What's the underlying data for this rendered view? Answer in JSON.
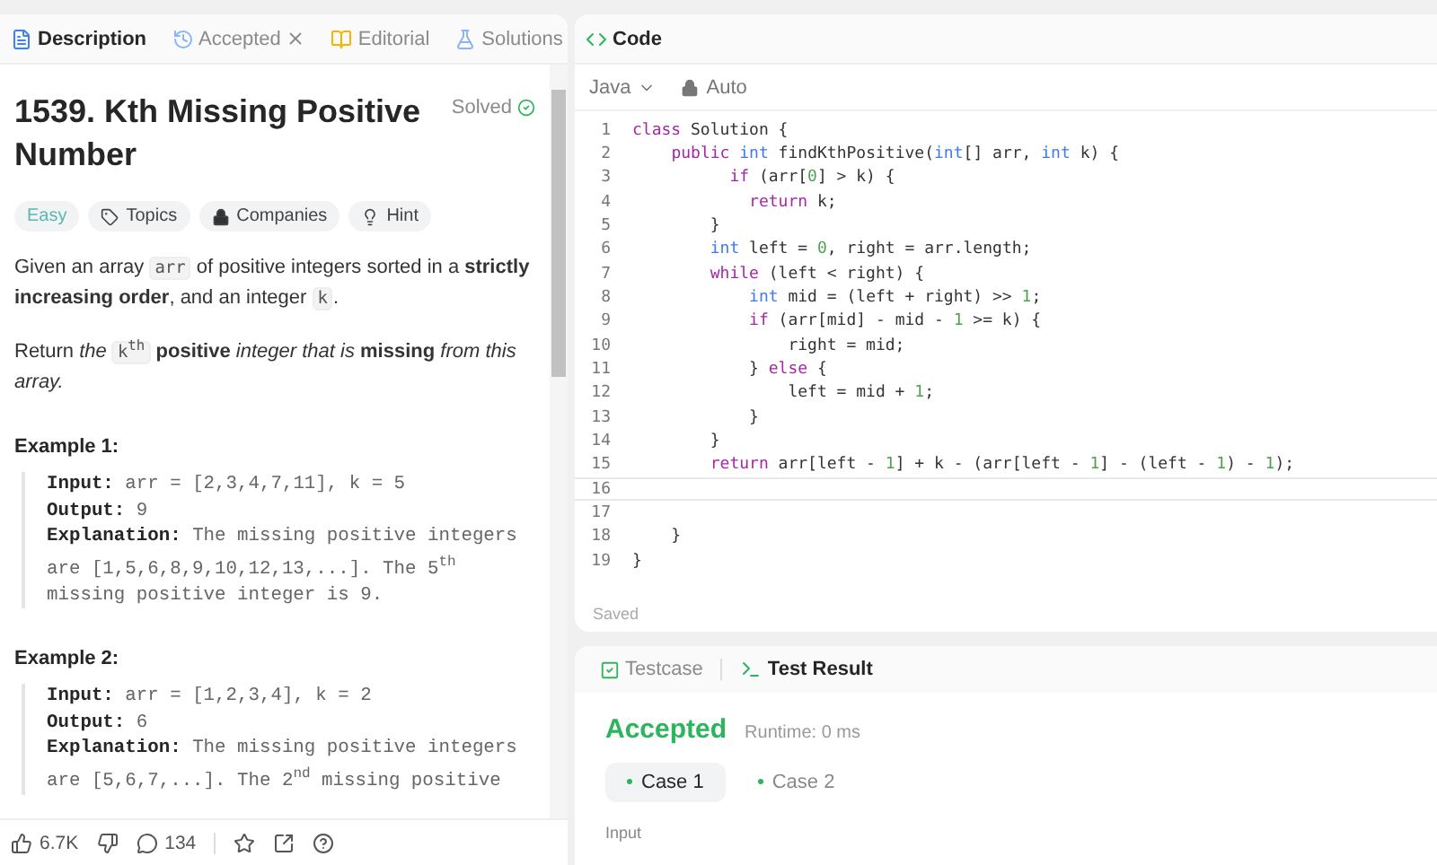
{
  "left_tabs": [
    {
      "label": "Description",
      "kind": "file",
      "selected": true,
      "closable": false
    },
    {
      "label": "Accepted",
      "kind": "history",
      "selected": false,
      "closable": true
    },
    {
      "label": "Editorial",
      "kind": "book",
      "selected": false,
      "closable": false
    },
    {
      "label": "Solutions",
      "kind": "flask",
      "selected": false,
      "closable": false
    }
  ],
  "problem": {
    "title": "1539. Kth Missing Positive Number",
    "status": "Solved",
    "tags": [
      {
        "label": "Easy",
        "kind": "difficulty"
      },
      {
        "label": "Topics",
        "kind": "tag"
      },
      {
        "label": "Companies",
        "kind": "lock"
      },
      {
        "label": "Hint",
        "kind": "bulb"
      }
    ],
    "paragraphs": [
      [
        {
          "kind": "text",
          "text": "Given an array "
        },
        {
          "kind": "code",
          "text": "arr"
        },
        {
          "kind": "text",
          "text": " of positive integers sorted in a **strictly increasing order**, and an integer "
        },
        {
          "kind": "code",
          "text": "k"
        },
        {
          "kind": "text",
          "text": "."
        }
      ],
      [
        {
          "kind": "text",
          "text": "Return *the* "
        },
        {
          "kind": "code",
          "text": "k$^{th}$"
        },
        {
          "kind": "text",
          "text": " **positive** *integer that is* **missing** *from this array.*"
        }
      ]
    ],
    "examples": [
      {
        "heading": "Example 1:",
        "lines": [
          "**Input:** arr = [2,3,4,7,11], k = 5",
          "**Output:** 9",
          "**Explanation:** The missing positive integers are [1,5,6,8,9,10,12,13,...]. The 5$^{th}$ missing positive integer is 9."
        ]
      },
      {
        "heading": "Example 2:",
        "lines": [
          "**Input:** arr = [1,2,3,4], k = 2",
          "**Output:** 6",
          "**Explanation:** The missing positive integers are [5,6,7,...]. The 2$^{nd}$ missing positive"
        ]
      }
    ]
  },
  "footer": {
    "likes": "6.7K",
    "comments": "134"
  },
  "code_panel": {
    "title": "Code",
    "language": "Java",
    "mode": "Auto",
    "status": "Saved",
    "lines": [
      {
        "number": "1",
        "text": "class Solution {",
        "current": false
      },
      {
        "number": "2",
        "text": "    public int findKthPositive(int[] arr, int k) {",
        "current": false
      },
      {
        "number": "3",
        "text": "          if (arr[0] > k) {",
        "current": false
      },
      {
        "number": "4",
        "text": "            return k;",
        "current": false
      },
      {
        "number": "5",
        "text": "        }",
        "current": false
      },
      {
        "number": "6",
        "text": "        int left = 0, right = arr.length;",
        "current": false
      },
      {
        "number": "7",
        "text": "        while (left < right) {",
        "current": false
      },
      {
        "number": "8",
        "text": "            int mid = (left + right) >> 1;",
        "current": false
      },
      {
        "number": "9",
        "text": "            if (arr[mid] - mid - 1 >= k) {",
        "current": false
      },
      {
        "number": "10",
        "text": "                right = mid;",
        "current": false
      },
      {
        "number": "11",
        "text": "            } else {",
        "current": false
      },
      {
        "number": "12",
        "text": "                left = mid + 1;",
        "current": false
      },
      {
        "number": "13",
        "text": "            }",
        "current": false
      },
      {
        "number": "14",
        "text": "        }",
        "current": false
      },
      {
        "number": "15",
        "text": "        return arr[left - 1] + k - (arr[left - 1] - (left - 1) - 1);",
        "current": false
      },
      {
        "number": "16",
        "current": true
      },
      {
        "number": "17",
        "current": false
      },
      {
        "number": "18",
        "text": "    }",
        "current": false
      },
      {
        "number": "19",
        "text": "}",
        "current": false
      }
    ]
  },
  "result_panel": {
    "tabs": [
      {
        "label": "Testcase",
        "kind": "check",
        "selected": false
      },
      {
        "label": "Test Result",
        "kind": "terminal",
        "selected": true
      }
    ],
    "verdict": "Accepted",
    "runtime": "Runtime: 0 ms",
    "cases": [
      {
        "label": "Case 1",
        "selected": true
      },
      {
        "label": "Case 2",
        "selected": false
      }
    ],
    "input_label": "Input"
  }
}
